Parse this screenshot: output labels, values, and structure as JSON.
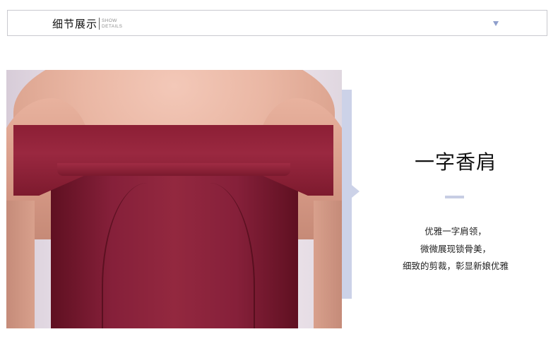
{
  "header": {
    "title": "细节展示",
    "sub_line1": "SHOW",
    "sub_line2": "DETAILS",
    "toggle_icon": "caret-down-icon",
    "accent_color": "#8f9fcc"
  },
  "feature": {
    "title": "一字香肩",
    "description": [
      "优雅一字肩领，",
      "微微展现锁骨美，",
      "细致的剪裁，彰显新娘优雅"
    ]
  },
  "photo": {
    "dress_color": "#8c1f35",
    "subject": "off-shoulder-dress-photo"
  },
  "colors": {
    "accent_bar": "#ccd2e8",
    "border": "#c9c9cf"
  }
}
